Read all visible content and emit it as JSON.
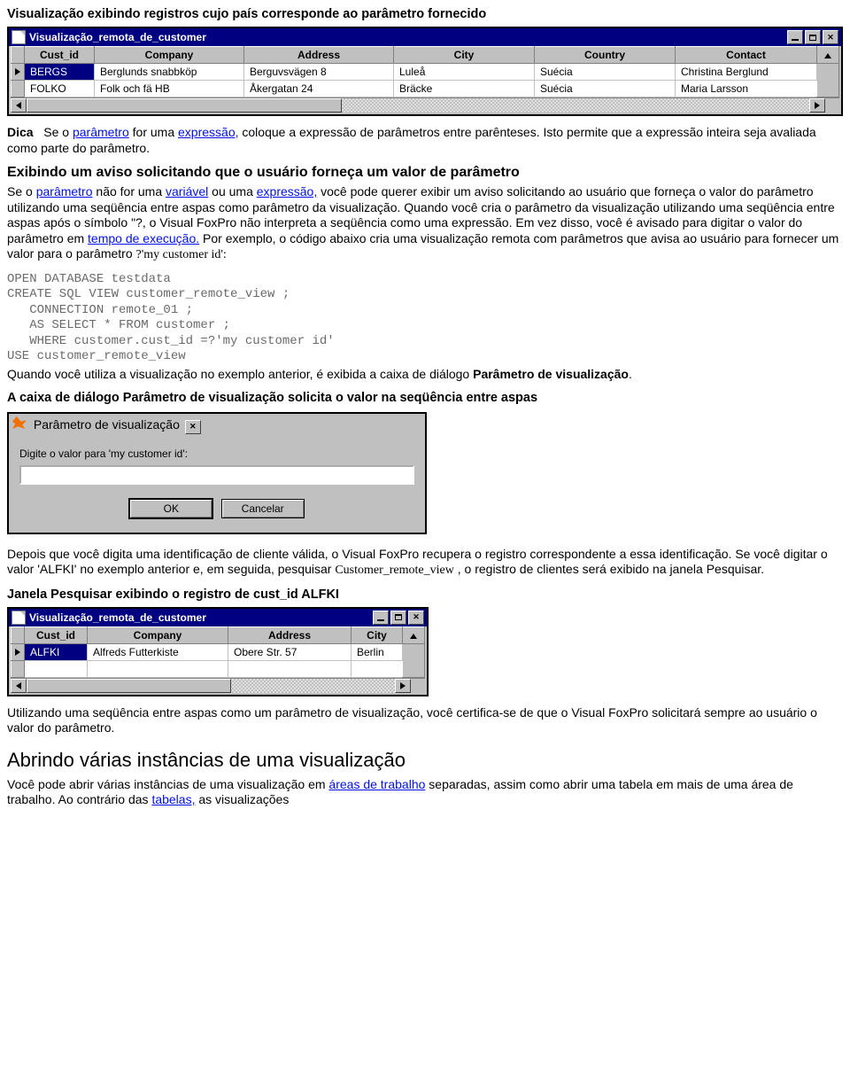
{
  "h1": "Visualização exibindo registros cujo país corresponde ao parâmetro fornecido",
  "grid1": {
    "title": "Visualização_remota_de_customer",
    "headers": [
      "Cust_id",
      "Company",
      "Address",
      "City",
      "Country",
      "Contact"
    ],
    "rows": [
      {
        "sel": true,
        "cells": [
          "BERGS",
          "Berglunds snabbköp",
          "Berguvsvägen  8",
          "Luleå",
          "Suécia",
          "Christina Berglund"
        ]
      },
      {
        "sel": false,
        "cells": [
          "FOLKO",
          "Folk och fä HB",
          "Åkergatan 24",
          "Bräcke",
          "Suécia",
          "Maria Larsson"
        ]
      }
    ]
  },
  "tip": {
    "label": "Dica",
    "t1": "Se o ",
    "link1": "parâmetro",
    "t2": " for uma ",
    "link2": "expressão,",
    "t3": " coloque a expressão de parâmetros entre parênteses. Isto permite que a expressão inteira seja avaliada como parte do parâmetro."
  },
  "h2": "Exibindo um aviso solicitando que o usuário forneça um valor de parâmetro",
  "p2": {
    "t1": "Se o ",
    "link1": "parâmetro",
    "t2": " não for uma ",
    "link2": "variável",
    "t3": " ou uma ",
    "link3": "expressão,",
    "t4": " você pode querer exibir um aviso solicitando ao usuário que forneça o valor do parâmetro utilizando uma seqüência entre aspas como parâmetro da visualização. Quando você cria o parâmetro da visualização utilizando uma seqüência entre aspas após o símbolo \"?, o Visual FoxPro não interpreta a seqüência como uma expressão. Em vez disso, você é avisado para digitar o valor do parâmetro em ",
    "link4": "tempo de execução.",
    "t5": " Por exemplo, o código abaixo cria uma visualização remota com parâmetros que avisa ao usuário para fornecer um valor para o parâmetro ",
    "tail": "?'my customer id':"
  },
  "code": "OPEN DATABASE testdata\nCREATE SQL VIEW customer_remote_view ;\n   CONNECTION remote_01 ;\n   AS SELECT * FROM customer ;\n   WHERE customer.cust_id =?'my customer id'\nUSE customer_remote_view",
  "p3a": "Quando você utiliza a visualização no exemplo anterior, é exibida a caixa de diálogo ",
  "p3b": "Parâmetro de visualização",
  "p3c": ".",
  "h3": "A caixa de diálogo Parâmetro de visualização solicita o valor na seqüência entre aspas",
  "dialog": {
    "title": "Parâmetro de visualização",
    "prompt": "Digite o valor para 'my customer id':",
    "ok": "OK",
    "cancel": "Cancelar"
  },
  "p4": {
    "t1": "Depois que você digita uma identificação de cliente válida, o Visual FoxPro recupera o registro correspondente a essa identificação. Se você digitar o valor 'ALFKI' no exemplo anterior e, em seguida, pesquisar ",
    "mono": "Customer_remote_view",
    "t2": ", o registro de clientes será exibido na janela Pesquisar."
  },
  "h4": "Janela Pesquisar exibindo o registro de cust_id ALFKI",
  "grid2": {
    "title": "Visualização_remota_de_customer",
    "headers": [
      "Cust_id",
      "Company",
      "Address",
      "City"
    ],
    "rows": [
      {
        "sel": true,
        "cells": [
          "ALFKI",
          "Alfreds Futterkiste",
          "Obere Str. 57",
          "Berlin"
        ]
      }
    ]
  },
  "p5": "Utilizando uma seqüência entre aspas como um parâmetro de visualização, você certifica-se de que o Visual FoxPro solicitará sempre ao usuário o valor do parâmetro.",
  "h5": "Abrindo várias instâncias de uma visualização",
  "p6": {
    "t1": "Você pode abrir várias instâncias de uma visualização em ",
    "link1": "áreas de trabalho",
    "t2": " separadas, assim como abrir uma tabela em mais de uma área de trabalho. Ao contrário das ",
    "link2": "tabelas,",
    "t3": " as visualizações"
  }
}
